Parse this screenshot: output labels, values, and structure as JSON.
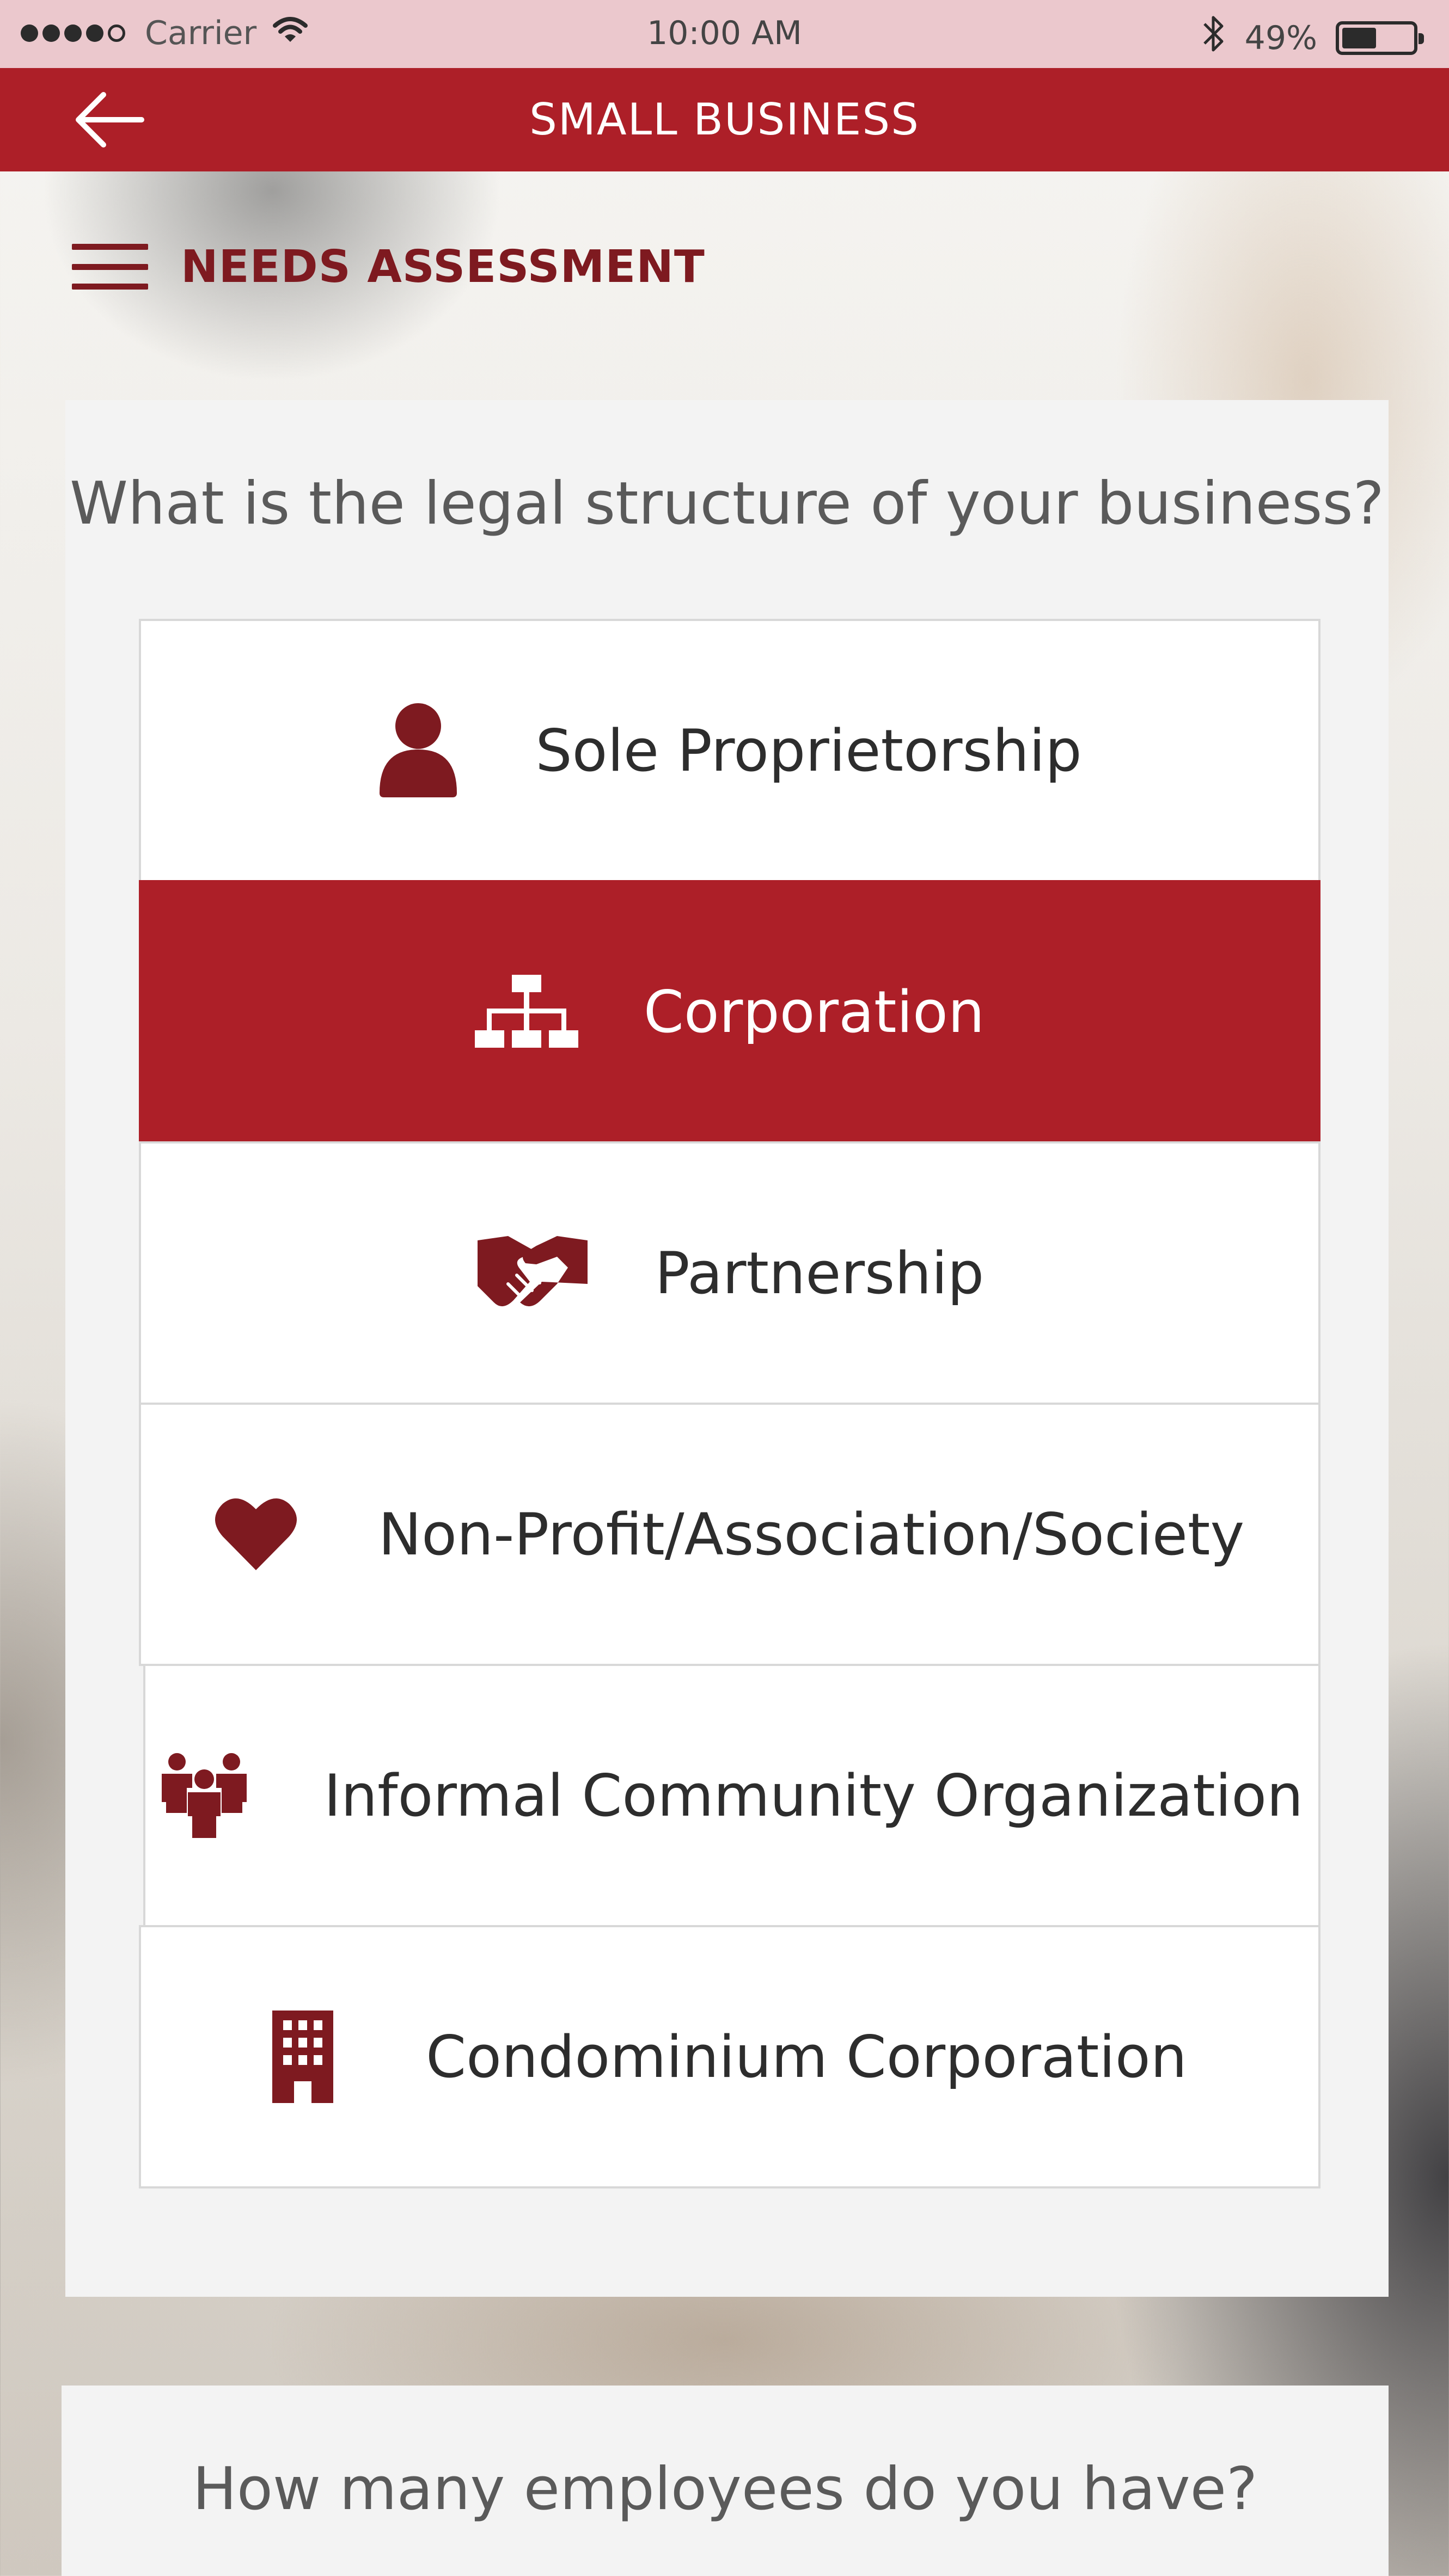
{
  "status_bar": {
    "carrier": "Carrier",
    "time": "10:00 AM",
    "battery_percent": "49%",
    "battery_level": 0.49
  },
  "header": {
    "title": "SMALL BUSINESS",
    "back_icon": "arrow-left-icon"
  },
  "section": {
    "title": "NEEDS ASSESSMENT",
    "menu_icon": "hamburger-menu-icon"
  },
  "question1": {
    "text": "What is the legal structure of your business?",
    "options": [
      {
        "label": "Sole Proprietorship",
        "icon": "person-icon",
        "selected": false
      },
      {
        "label": "Corporation",
        "icon": "org-chart-icon",
        "selected": true
      },
      {
        "label": "Partnership",
        "icon": "handshake-icon",
        "selected": false
      },
      {
        "label": "Non-Profit/Association/Society",
        "icon": "heart-icon",
        "selected": false
      },
      {
        "label": "Informal Community Organization",
        "icon": "group-icon",
        "selected": false
      },
      {
        "label": "Condominium Corporation",
        "icon": "building-icon",
        "selected": false
      }
    ]
  },
  "question2": {
    "text": "How many employees do you have?"
  },
  "colors": {
    "brand_red": "#ad1f28",
    "dark_red": "#7e1a20",
    "status_bar_bg": "#ebc8cd",
    "card_bg": "#f3f3f3"
  }
}
